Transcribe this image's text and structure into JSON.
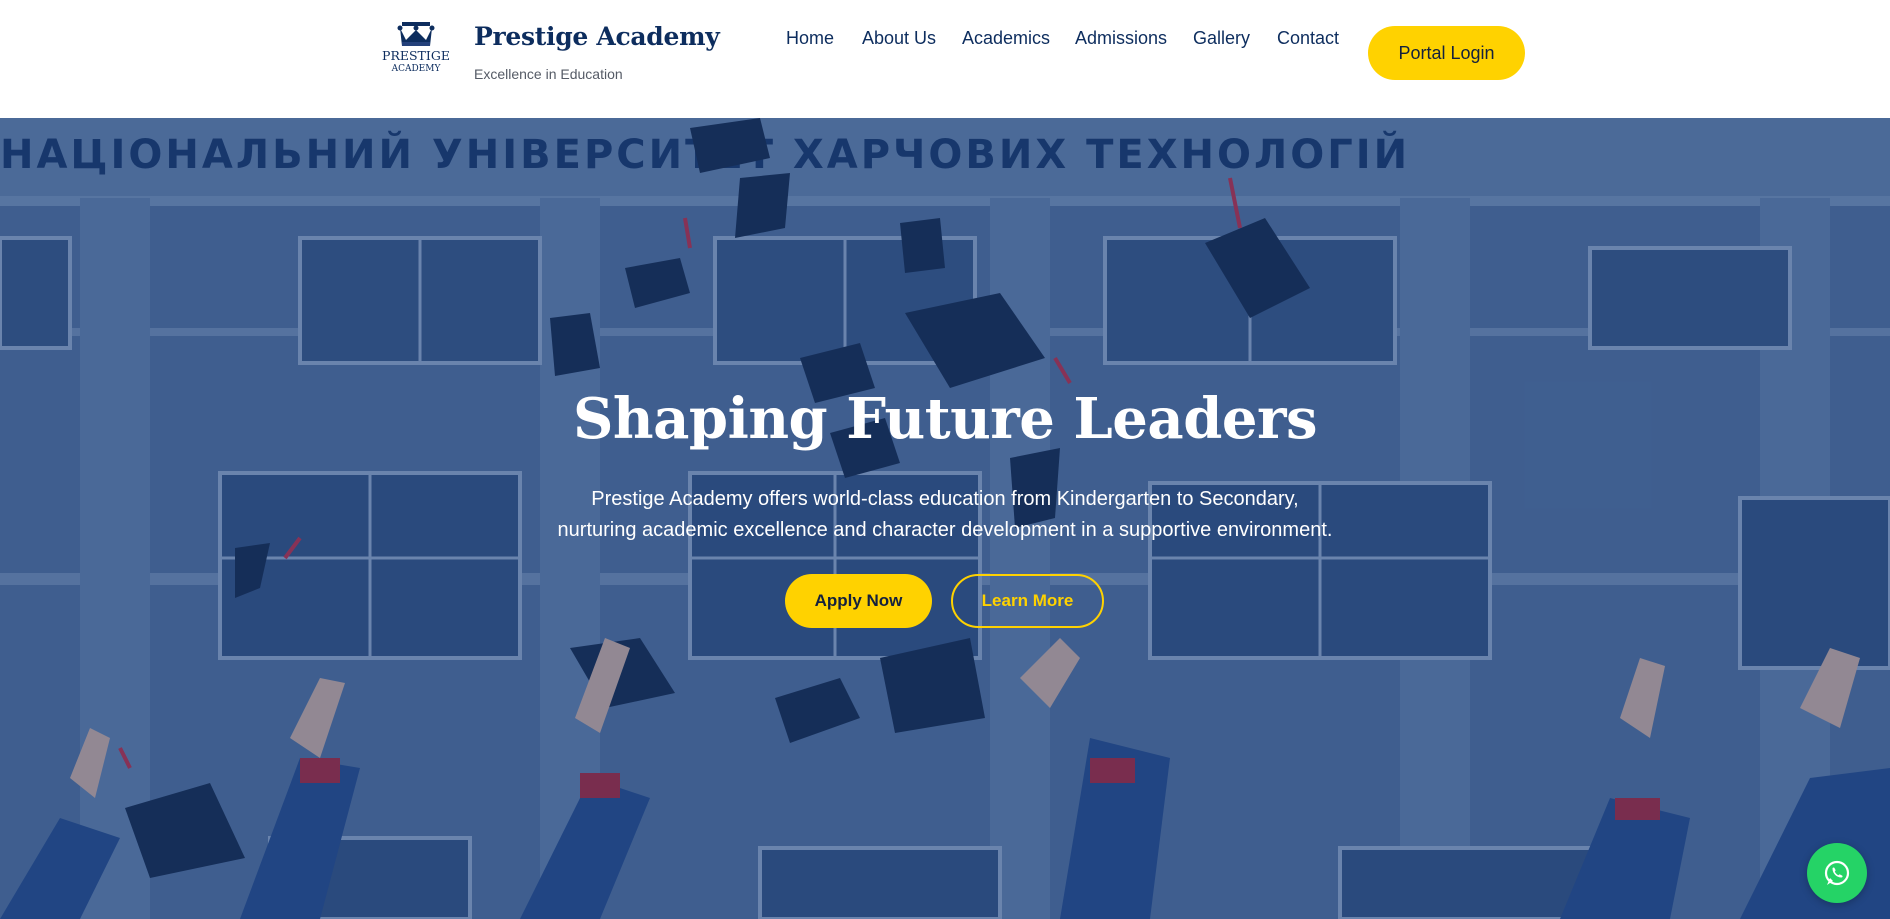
{
  "brand": {
    "name": "Prestige Academy",
    "tagline": "Excellence in Education",
    "logo_text_top": "PRESTIGE",
    "logo_text_bottom": "ACADEMY"
  },
  "nav": {
    "items": [
      {
        "label": "Home"
      },
      {
        "label": "About Us"
      },
      {
        "label": "Academics"
      },
      {
        "label": "Admissions"
      },
      {
        "label": "Gallery"
      },
      {
        "label": "Contact"
      }
    ],
    "portal_label": "Portal Login"
  },
  "hero": {
    "title": "Shaping Future Leaders",
    "subtitle_line1": "Prestige Academy offers world-class education from Kindergarten to Secondary,",
    "subtitle_line2": "nurturing academic excellence and character development in a supportive environment.",
    "apply_label": "Apply Now",
    "learn_label": "Learn More",
    "building_sign": "НАЦІОНАЛЬНИЙ УНІВЕРСИТЕТ ХАРЧОВИХ ТЕХНОЛОГІЙ"
  },
  "icons": {
    "logo": "crown-icon",
    "chat": "whatsapp-icon"
  },
  "colors": {
    "navy": "#0d2d5e",
    "accent_yellow": "#ffd200",
    "whatsapp_green": "#25d366"
  }
}
